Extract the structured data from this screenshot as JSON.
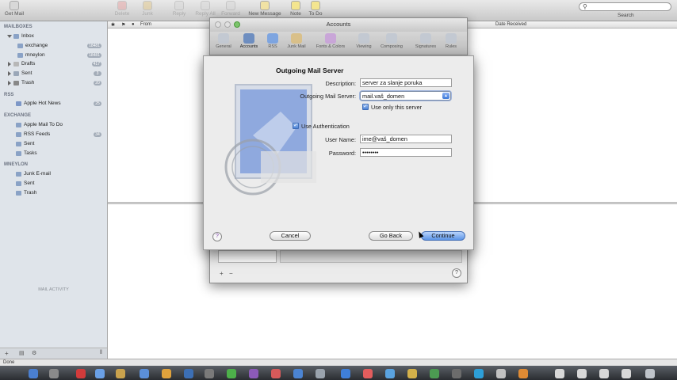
{
  "toolbar": {
    "buttons": [
      {
        "label": "Get Mail",
        "icon": "envelope-icon",
        "enabled": true
      },
      {
        "label": "Delete",
        "icon": "delete-icon",
        "enabled": false
      },
      {
        "label": "Junk",
        "icon": "junk-icon",
        "enabled": false
      },
      {
        "label": "Reply",
        "icon": "reply-icon",
        "enabled": false
      },
      {
        "label": "Reply All",
        "icon": "reply-all-icon",
        "enabled": false
      },
      {
        "label": "Forward",
        "icon": "forward-icon",
        "enabled": false
      },
      {
        "label": "New Message",
        "icon": "compose-icon",
        "enabled": true
      },
      {
        "label": "Note",
        "icon": "note-icon",
        "enabled": true
      },
      {
        "label": "To Do",
        "icon": "todo-icon",
        "enabled": true
      }
    ],
    "search_label": "Search"
  },
  "sidebar": {
    "sections": [
      {
        "header": "MAILBOXES",
        "items": [
          {
            "label": "Inbox",
            "badge": ""
          },
          {
            "label": "exchange",
            "badge": "18481"
          },
          {
            "label": "mneylon",
            "badge": "18481"
          },
          {
            "label": "Drafts",
            "badge": "417"
          },
          {
            "label": "Sent",
            "badge": "3"
          },
          {
            "label": "Trash",
            "badge": "20"
          }
        ]
      },
      {
        "header": "RSS",
        "items": [
          {
            "label": "Apple Hot News",
            "badge": "25"
          }
        ]
      },
      {
        "header": "EXCHANGE",
        "items": [
          {
            "label": "Apple Mail To Do",
            "badge": ""
          },
          {
            "label": "RSS Feeds",
            "badge": "34"
          },
          {
            "label": "Sent",
            "badge": ""
          },
          {
            "label": "Tasks",
            "badge": ""
          }
        ]
      },
      {
        "header": "MNEYLON",
        "items": [
          {
            "label": "Junk E-mail",
            "badge": ""
          },
          {
            "label": "Sent",
            "badge": ""
          },
          {
            "label": "Trash",
            "badge": ""
          }
        ]
      }
    ],
    "activity_label": "MAIL ACTIVITY"
  },
  "message_list": {
    "columns": [
      "From",
      "Date Received"
    ]
  },
  "status": "Done",
  "prefs_window": {
    "title": "Accounts",
    "tabs": [
      {
        "label": "General",
        "icon": "switch-icon",
        "active": false
      },
      {
        "label": "Accounts",
        "icon": "at-sign-icon",
        "active": true
      },
      {
        "label": "RSS",
        "icon": "rss-icon",
        "active": false
      },
      {
        "label": "Junk Mail",
        "icon": "junk-bag-icon",
        "active": false
      },
      {
        "label": "Fonts & Colors",
        "icon": "fonts-colors-icon",
        "active": false
      },
      {
        "label": "Viewing",
        "icon": "glasses-icon",
        "active": false
      },
      {
        "label": "Composing",
        "icon": "composing-icon",
        "active": false
      },
      {
        "label": "Signatures",
        "icon": "signature-icon",
        "active": false
      },
      {
        "label": "Rules",
        "icon": "rules-icon",
        "active": false
      }
    ]
  },
  "sheet": {
    "title": "Outgoing Mail Server",
    "description_label": "Description:",
    "description_value": "server za slanje poruka",
    "server_label": "Outgoing Mail Server:",
    "server_value": "mail.vaš_domen",
    "only_this_server_label": "Use only this server",
    "only_this_server_checked": true,
    "use_auth_label": "Use Authentication",
    "use_auth_checked": true,
    "username_label": "User Name:",
    "username_value": "ime@vaš_domen",
    "password_label": "Password:",
    "password_value": "••••••••",
    "cancel_label": "Cancel",
    "go_back_label": "Go Back",
    "continue_label": "Continue",
    "help_label": "?"
  },
  "colors": {
    "accent": "#5b94e6",
    "sidebar_bg": "#dfe4ea"
  }
}
